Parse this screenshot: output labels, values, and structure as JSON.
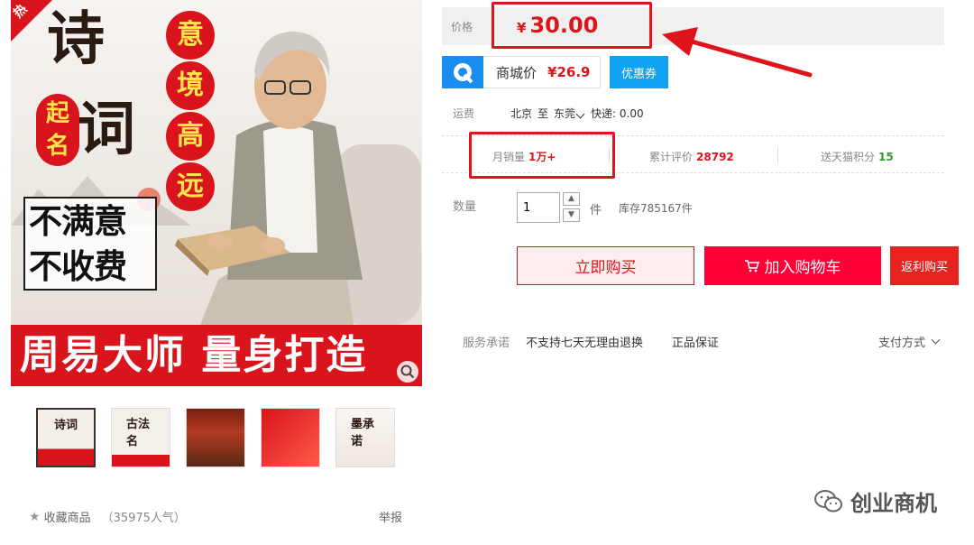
{
  "product_image": {
    "hot_label": "热",
    "poem_char_1": "诗",
    "poem_char_2": "词",
    "qiming": "起名",
    "yijing": [
      "意",
      "境",
      "高",
      "远"
    ],
    "guarantee_line_1": "不满意",
    "guarantee_line_2": "不收费",
    "banner": "周易大师  量身打造",
    "zoom_icon": "magnifier-icon"
  },
  "thumbnails": [
    {
      "mark": "诗词"
    },
    {
      "mark": "古法名"
    },
    {
      "mark": ""
    },
    {
      "mark": ""
    },
    {
      "mark": "墨承诺"
    }
  ],
  "favorite": {
    "label": "收藏商品",
    "count": "（35975人气）"
  },
  "report_label": "举报",
  "price": {
    "label": "价格",
    "currency": "¥",
    "value": "30.00"
  },
  "mall": {
    "label": "商城价",
    "price": "¥26.9",
    "coupon": "优惠券"
  },
  "shipping": {
    "label": "运费",
    "from": "北京",
    "to_word": "至",
    "to": "东莞",
    "method": "快递: 0.00"
  },
  "stats": {
    "monthly_sales_label": "月销量",
    "monthly_sales_value": "1万+",
    "reviews_label": "累计评价",
    "reviews_value": "28792",
    "points_label": "送天猫积分",
    "points_value": "15"
  },
  "quantity": {
    "label": "数量",
    "value": "1",
    "unit": "件",
    "stock": "库存785167件"
  },
  "buttons": {
    "buy_now": "立即购买",
    "add_cart": "加入购物车",
    "rebate": "返利购买"
  },
  "service": {
    "label": "服务承诺",
    "items": [
      "不支持七天无理由退换",
      "正品保证"
    ],
    "payment": "支付方式"
  },
  "watermark": "创业商机",
  "colors": {
    "accent_red": "#e0131b",
    "tmall_red": "#ff0036",
    "mall_blue": "#1a8ef0"
  }
}
